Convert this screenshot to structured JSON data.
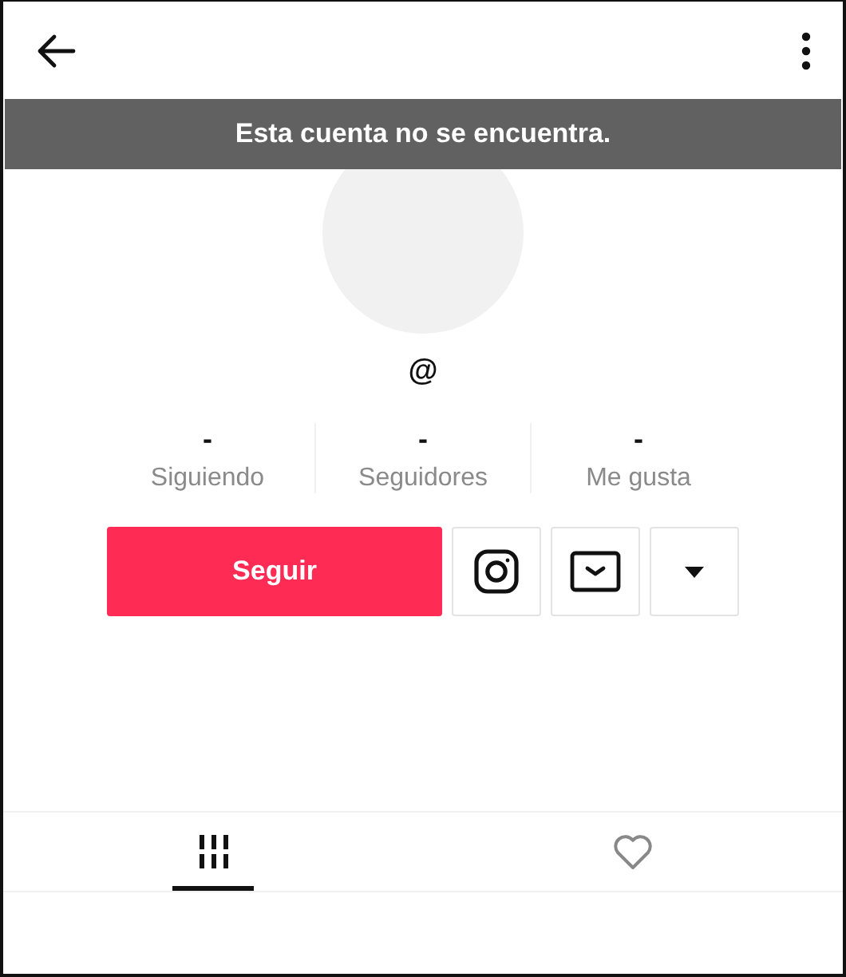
{
  "header": {
    "actions": [
      {
        "kind": "back"
      },
      {
        "kind": "more"
      }
    ]
  },
  "banner": {
    "text": "Esta cuenta no se encuentra."
  },
  "profile": {
    "username": "@"
  },
  "stats": [
    {
      "value": "-",
      "label": "Siguiendo"
    },
    {
      "value": "-",
      "label": "Seguidores"
    },
    {
      "value": "-",
      "label": "Me gusta"
    }
  ],
  "follow_button": {
    "label": "Seguir"
  },
  "icon_buttons": [
    {
      "kind": "instagram"
    },
    {
      "kind": "message"
    },
    {
      "kind": "dropdown"
    }
  ],
  "tabs": [
    {
      "kind": "videos",
      "selected": true
    },
    {
      "kind": "liked",
      "selected": false
    }
  ]
}
